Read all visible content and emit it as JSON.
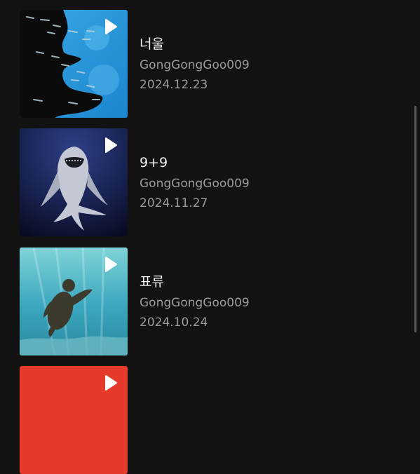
{
  "videos": [
    {
      "title": "너울",
      "channel": "GongGongGoo009",
      "date": "2024.12.23",
      "thumbnail": "fish-school-over-reef-thumbnail",
      "colors": [
        "#1a8fd6",
        "#4fb4ea",
        "#0b0b0b"
      ]
    },
    {
      "title": "9+9",
      "channel": "GongGongGoo009",
      "date": "2024.11.27",
      "thumbnail": "shark-thumbnail",
      "colors": [
        "#1e2a63",
        "#0a1030",
        "#c9ccd6"
      ]
    },
    {
      "title": "표류",
      "channel": "GongGongGoo009",
      "date": "2024.10.24",
      "thumbnail": "sea-turtle-thumbnail",
      "colors": [
        "#5fc6cf",
        "#2a8ea6",
        "#3b3b2e"
      ]
    },
    {
      "thumbnail": "red-thumbnail",
      "colors": [
        "#e63a2a"
      ]
    }
  ],
  "icons": {
    "play": "play-icon"
  }
}
